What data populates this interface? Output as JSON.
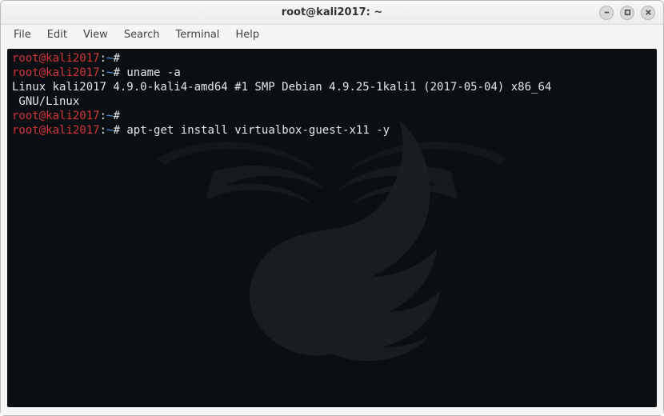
{
  "window": {
    "title": "root@kali2017: ~"
  },
  "menubar": {
    "items": [
      {
        "label": "File"
      },
      {
        "label": "Edit"
      },
      {
        "label": "View"
      },
      {
        "label": "Search"
      },
      {
        "label": "Terminal"
      },
      {
        "label": "Help"
      }
    ]
  },
  "prompt": {
    "user": "root",
    "at": "@",
    "host": "kali2017",
    "colon": ":",
    "path": "~",
    "symbol": "#"
  },
  "lines": [
    {
      "type": "prompt",
      "command": ""
    },
    {
      "type": "prompt",
      "command": "uname -a"
    },
    {
      "type": "output",
      "text": "Linux kali2017 4.9.0-kali4-amd64 #1 SMP Debian 4.9.25-1kali1 (2017-05-04) x86_64"
    },
    {
      "type": "output",
      "text": " GNU/Linux"
    },
    {
      "type": "prompt",
      "command": ""
    },
    {
      "type": "prompt",
      "command": "apt-get install virtualbox-guest-x11 -y"
    }
  ]
}
